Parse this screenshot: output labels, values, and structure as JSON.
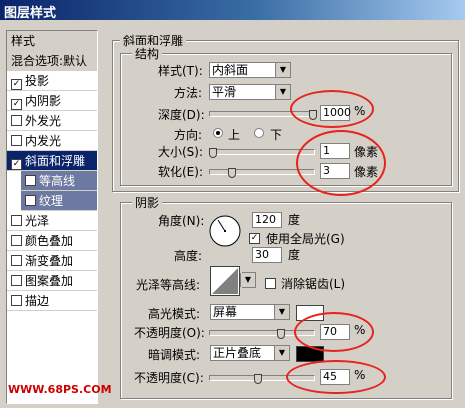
{
  "window": {
    "title": "图层样式"
  },
  "sidebar": {
    "items": [
      {
        "label": "样式",
        "checked": null,
        "state": "head"
      },
      {
        "label": "混合选项:默认",
        "checked": null,
        "state": "head"
      },
      {
        "label": "投影",
        "checked": true,
        "state": "normal"
      },
      {
        "label": "内阴影",
        "checked": true,
        "state": "normal"
      },
      {
        "label": "外发光",
        "checked": false,
        "state": "normal"
      },
      {
        "label": "内发光",
        "checked": false,
        "state": "normal"
      },
      {
        "label": "斜面和浮雕",
        "checked": true,
        "state": "selected"
      },
      {
        "label": "等高线",
        "checked": false,
        "state": "sub"
      },
      {
        "label": "纹理",
        "checked": false,
        "state": "sub"
      },
      {
        "label": "光泽",
        "checked": false,
        "state": "normal"
      },
      {
        "label": "颜色叠加",
        "checked": false,
        "state": "normal"
      },
      {
        "label": "渐变叠加",
        "checked": false,
        "state": "normal"
      },
      {
        "label": "图案叠加",
        "checked": false,
        "state": "normal"
      },
      {
        "label": "描边",
        "checked": false,
        "state": "normal"
      }
    ]
  },
  "bevel": {
    "group_title": "斜面和浮雕",
    "structure_title": "结构",
    "style_label": "样式(T):",
    "style_value": "内斜面",
    "technique_label": "方法:",
    "technique_value": "平滑",
    "depth_label": "深度(D):",
    "depth_value": "1000",
    "depth_unit": "%",
    "depth_fraction": 1.0,
    "direction_label": "方向:",
    "direction_up": "上",
    "direction_down": "下",
    "size_label": "大小(S):",
    "size_value": "1",
    "size_unit": "像素",
    "size_fraction": 0.0,
    "soften_label": "软化(E):",
    "soften_value": "3",
    "soften_unit": "像素",
    "soften_fraction": 0.2
  },
  "shading": {
    "title": "阴影",
    "angle_label": "角度(N):",
    "angle_value": "120",
    "angle_unit": "度",
    "global_light_label": "使用全局光(G)",
    "altitude_label": "高度:",
    "altitude_value": "30",
    "altitude_unit": "度",
    "gloss_label": "光泽等高线:",
    "antialias_label": "消除锯齿(L)",
    "highlight_label": "高光模式:",
    "highlight_mode": "屏幕",
    "highlight_color": "#ffffff",
    "highlight_opacity_label": "不透明度(O):",
    "highlight_opacity_value": "70",
    "highlight_opacity_unit": "%",
    "highlight_opacity_fraction": 0.7,
    "shadow_label": "暗调模式:",
    "shadow_mode": "正片叠底",
    "shadow_color": "#000000",
    "shadow_opacity_label": "不透明度(C):",
    "shadow_opacity_value": "45",
    "shadow_opacity_unit": "%",
    "shadow_opacity_fraction": 0.45
  },
  "watermark": "WWW.68PS.COM",
  "colors": {
    "annotation": "#e8221c",
    "selected": "#0a246a"
  }
}
